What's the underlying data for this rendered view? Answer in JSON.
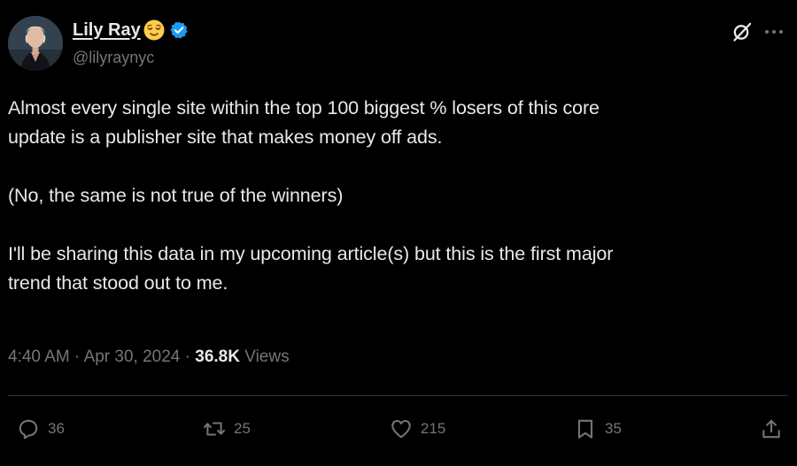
{
  "author": {
    "display_name": "Lily Ray",
    "handle": "@lilyraynyc",
    "emoji_icon": "relieved-face-emoji",
    "verified_color": "#1d9bf0"
  },
  "tweet": {
    "paragraphs": [
      [
        "Almost every single site within the top 100 biggest % losers of this core",
        "update is a publisher site that makes money off ads."
      ],
      [
        "(No, the same is not true of the winners)"
      ],
      [
        "I'll be sharing this data in my upcoming article(s) but this is the first major",
        "trend that stood out to me."
      ]
    ],
    "time": "4:40 AM",
    "date": "Apr 30, 2024",
    "separator": "·",
    "views_count": "36.8K",
    "views_label": "Views"
  },
  "actions": {
    "replies": "36",
    "reposts": "25",
    "likes": "215",
    "bookmarks": "35"
  },
  "colors": {
    "background": "#000000",
    "text": "#e7e9ea",
    "muted": "#71767b",
    "divider": "#2f3336",
    "accent": "#1d9bf0"
  }
}
